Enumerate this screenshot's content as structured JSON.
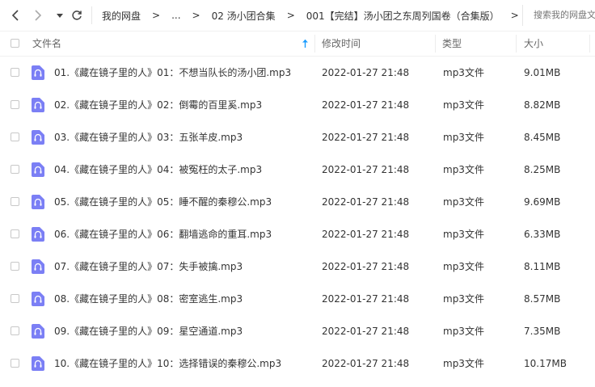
{
  "toolbar": {
    "back_icon": "chevron-left-icon",
    "forward_icon": "chevron-right-icon",
    "history_icon": "caret-down-icon",
    "refresh_icon": "refresh-icon"
  },
  "breadcrumb": {
    "items": [
      "我的网盘",
      "...",
      "02 汤小团合集",
      "001【完结】汤小团之东周列国卷（合集版）"
    ],
    "separator": ">"
  },
  "search": {
    "placeholder": "搜索我的网盘文件"
  },
  "columns": {
    "name": "文件名",
    "modified": "修改时间",
    "type": "类型",
    "size": "大小",
    "sort_icon": "sort-arrow-up-icon"
  },
  "colors": {
    "accent": "#1a9cff",
    "file_icon": "#7b7ff5"
  },
  "files": [
    {
      "name": "01.《藏在镜子里的人》01：不想当队长的汤小团.mp3",
      "modified": "2022-01-27 21:48",
      "type": "mp3文件",
      "size": "9.01MB"
    },
    {
      "name": "02.《藏在镜子里的人》02：倒霉的百里奚.mp3",
      "modified": "2022-01-27 21:48",
      "type": "mp3文件",
      "size": "8.82MB"
    },
    {
      "name": "03.《藏在镜子里的人》03：五张羊皮.mp3",
      "modified": "2022-01-27 21:48",
      "type": "mp3文件",
      "size": "8.45MB"
    },
    {
      "name": "04.《藏在镜子里的人》04：被冤枉的太子.mp3",
      "modified": "2022-01-27 21:48",
      "type": "mp3文件",
      "size": "8.25MB"
    },
    {
      "name": "05.《藏在镜子里的人》05：睡不醒的秦穆公.mp3",
      "modified": "2022-01-27 21:48",
      "type": "mp3文件",
      "size": "9.69MB"
    },
    {
      "name": "06.《藏在镜子里的人》06：翻墙逃命的重耳.mp3",
      "modified": "2022-01-27 21:48",
      "type": "mp3文件",
      "size": "6.33MB"
    },
    {
      "name": "07.《藏在镜子里的人》07：失手被擒.mp3",
      "modified": "2022-01-27 21:48",
      "type": "mp3文件",
      "size": "8.11MB"
    },
    {
      "name": "08.《藏在镜子里的人》08：密室逃生.mp3",
      "modified": "2022-01-27 21:48",
      "type": "mp3文件",
      "size": "8.57MB"
    },
    {
      "name": "09.《藏在镜子里的人》09：星空通道.mp3",
      "modified": "2022-01-27 21:48",
      "type": "mp3文件",
      "size": "7.35MB"
    },
    {
      "name": "10.《藏在镜子里的人》10：选择错误的秦穆公.mp3",
      "modified": "2022-01-27 21:48",
      "type": "mp3文件",
      "size": "10.17MB"
    }
  ]
}
